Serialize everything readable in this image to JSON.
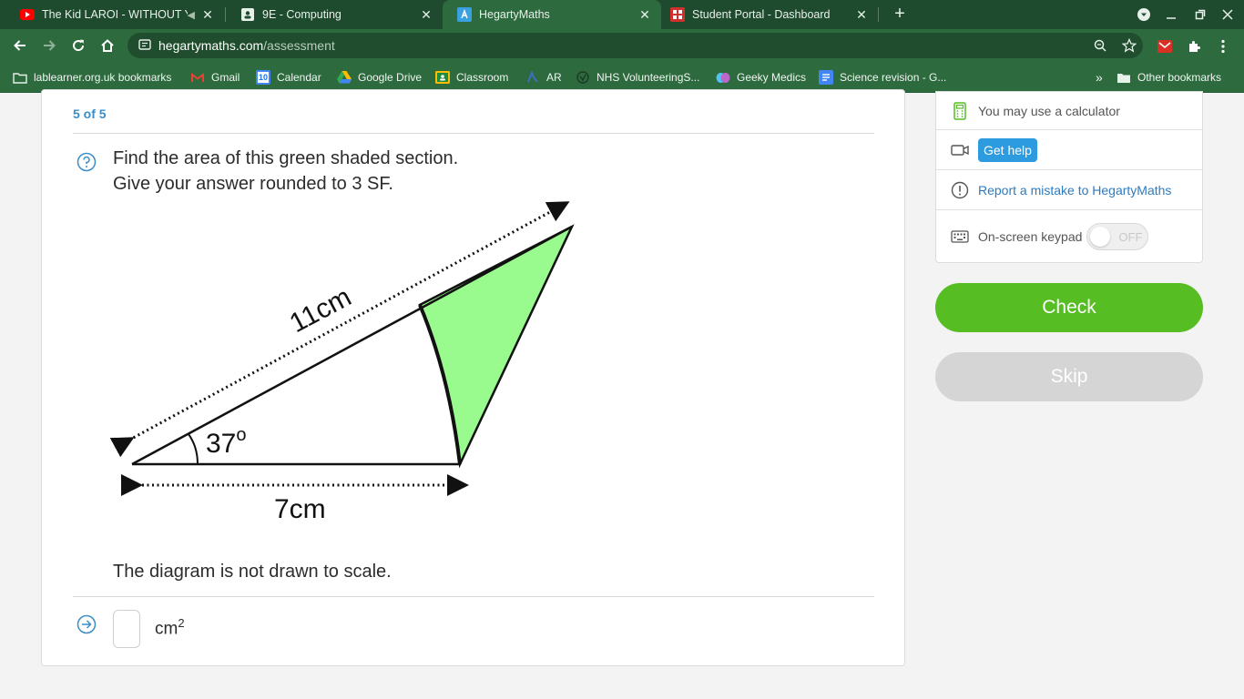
{
  "browser": {
    "tabs": [
      {
        "title": "The Kid LAROI - WITHOUT YOU",
        "icon": "youtube-icon"
      },
      {
        "title": "9E - Computing",
        "icon": "classroom-icon"
      },
      {
        "title": "HegartyMaths",
        "icon": "hegarty-icon"
      },
      {
        "title": "Student Portal - Dashboard",
        "icon": "portal-icon"
      }
    ],
    "url_domain": "hegartymaths.com",
    "url_path": "/assessment",
    "bookmarks": [
      {
        "label": "lablearner.org.uk bookmarks",
        "icon": "folder-icon"
      },
      {
        "label": "Gmail",
        "icon": "gmail-icon"
      },
      {
        "label": "Calendar",
        "icon": "calendar-icon"
      },
      {
        "label": "Google Drive",
        "icon": "drive-icon"
      },
      {
        "label": "Classroom",
        "icon": "classroom-icon"
      },
      {
        "label": "AR",
        "icon": "ar-icon"
      },
      {
        "label": "NHS VolunteeringS...",
        "icon": "nhs-icon"
      },
      {
        "label": "Geeky Medics",
        "icon": "brain-icon"
      },
      {
        "label": "Science revision - G...",
        "icon": "docs-icon"
      }
    ],
    "other_bookmarks": "Other bookmarks",
    "calendar_day": "10"
  },
  "question": {
    "counter": "5 of 5",
    "line1": "Find the area of this green shaded section.",
    "line2": "Give your answer rounded to 3 SF.",
    "note": "The diagram is not drawn to scale.",
    "unit": "cm",
    "unit_power": "2"
  },
  "diagram": {
    "long_side": "11cm",
    "base": "7cm",
    "angle": "37",
    "angle_unit": "o",
    "shade_color": "#99fa8e"
  },
  "sidebar": {
    "calculator": "You may use a calculator",
    "help": "Get help",
    "report": "Report a mistake to HegartyMaths",
    "keypad": "On-screen keypad",
    "keypad_state": "OFF"
  },
  "actions": {
    "check": "Check",
    "skip": "Skip"
  },
  "colors": {
    "chrome": "#2d6a3e",
    "accent_blue": "#3a8dc6",
    "check_green": "#56bd23"
  }
}
